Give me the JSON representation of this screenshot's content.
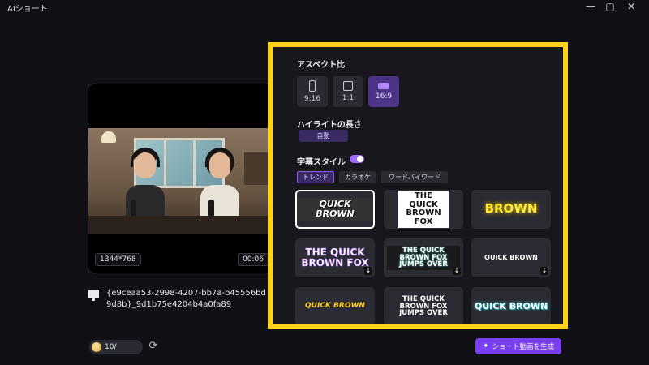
{
  "app": {
    "title": "AIショート"
  },
  "window_controls": {
    "minimize": "—",
    "maximize": "▢",
    "close": "✕"
  },
  "preview": {
    "resolution": "1344*768",
    "duration": "00:06",
    "file_name": "{e9ceaa53-2998-4207-bb7a-b45556bd9d8b}_9d1b75e4204b4a0fa89"
  },
  "credits": {
    "value": "10/"
  },
  "settings": {
    "aspect_title": "アスペクト比",
    "aspect_options": [
      {
        "label": "9:16"
      },
      {
        "label": "1:1"
      },
      {
        "label": "16:9",
        "selected": true
      }
    ],
    "highlight_title": "ハイライトの長さ",
    "highlight_value": "自動",
    "caption_title": "字幕スタイル",
    "caption_enabled": true,
    "caption_tabs": [
      {
        "label": "トレンド",
        "active": true
      },
      {
        "label": "カラオケ"
      },
      {
        "label": "ワードバイワード"
      }
    ],
    "styles": [
      {
        "text": "QUICK BROWN",
        "selected": true
      },
      {
        "text": "THE QUICK BROWN FOX"
      },
      {
        "text": "BROWN"
      },
      {
        "text": "THE QUICK BROWN FOX"
      },
      {
        "text": "THE QUICK BROWN FOX JUMPS OVER"
      },
      {
        "text": "QUICK BROWN"
      },
      {
        "text": "QUICK BROWN"
      },
      {
        "text": "THE QUICK BROWN FOX JUMPS OVER"
      },
      {
        "text": "QUICK BROWN"
      }
    ]
  },
  "generate_button": {
    "label": "ショート動画を生成"
  },
  "colors": {
    "accent": "#7a3ff0",
    "highlight_border": "#ffd21a",
    "background": "#101015"
  }
}
